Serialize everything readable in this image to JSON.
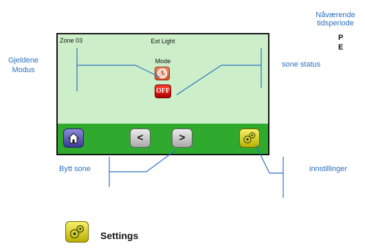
{
  "screen": {
    "zone": "Zone 03",
    "title": "Ext Light",
    "mode_label": "Mode",
    "off_label": "OFF",
    "prev_label": "<",
    "next_label": ">"
  },
  "annotations": {
    "current_period_line1": "Nåværende",
    "current_period_line2": "tidsperiode",
    "current_mode_line1": "Gjeldene",
    "current_mode_line2": "Modus",
    "zone_status": "sone status",
    "change_zone": "Bytt sone",
    "settings": "innstillinger"
  },
  "legend": {
    "settings_label": "Settings"
  },
  "cut_text": {
    "p": "P",
    "e": "E"
  },
  "icons": {
    "mode": "clock-icon",
    "home": "home-icon",
    "settings": "gears-icon"
  },
  "colors": {
    "screen_bg": "#ccefc9",
    "bar_bg": "#2faa2f",
    "annotation": "#2a70c0",
    "off_button": "#d11a0f"
  }
}
